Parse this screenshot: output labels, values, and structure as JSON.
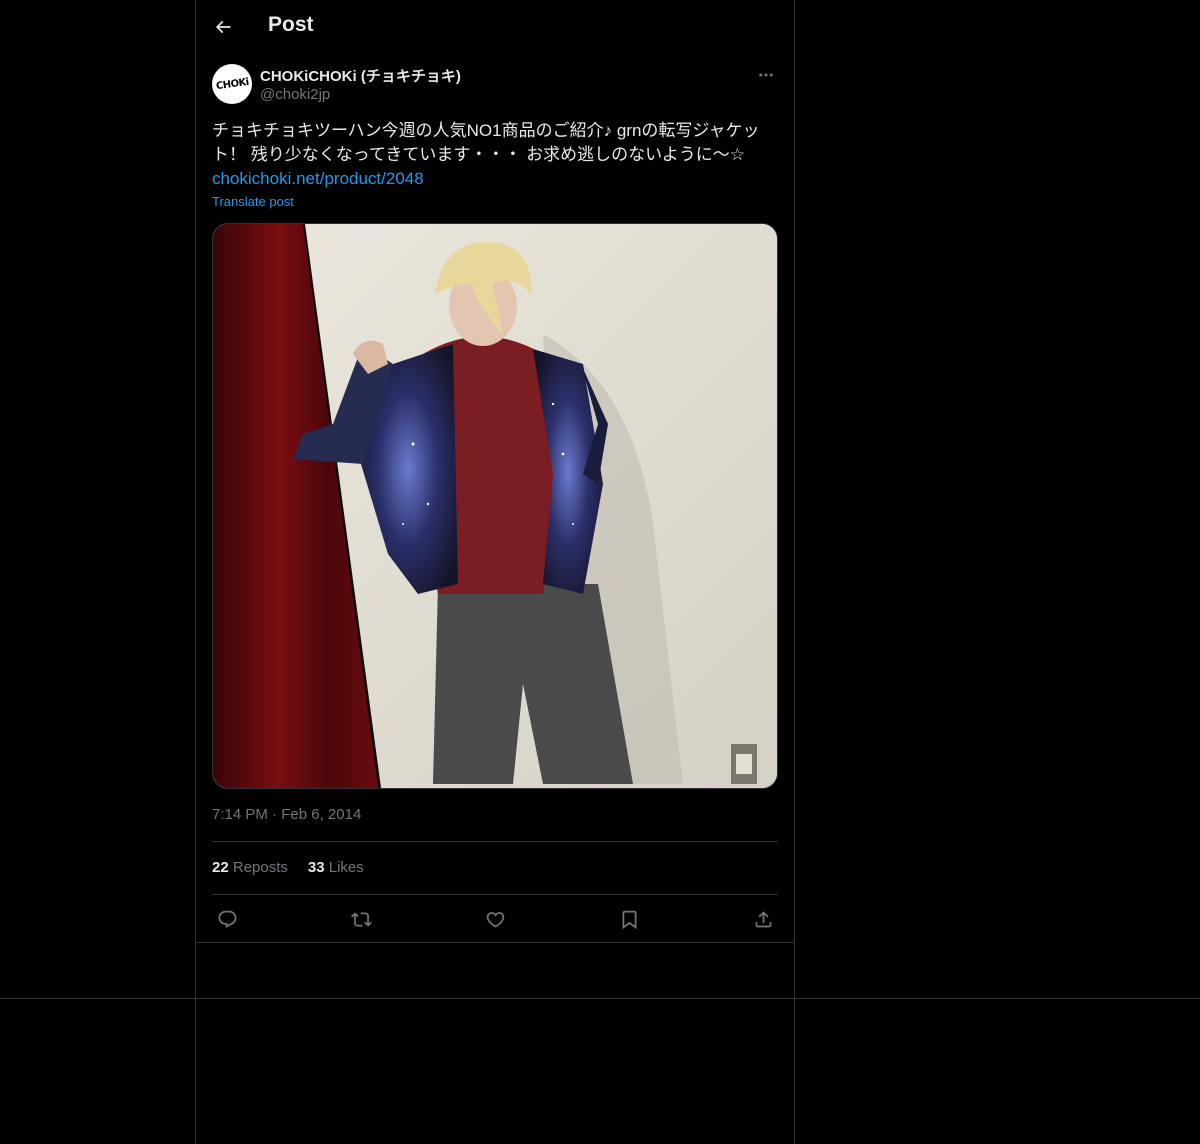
{
  "header": {
    "title": "Post"
  },
  "author": {
    "display_name": "CHOKiCHOKi (チョキチョキ)",
    "handle": "@choki2jp",
    "avatar_text": "CHOKi"
  },
  "tweet": {
    "text": "チョキチョキツーハン今週の人気NO1商品のご紹介♪ grnの転写ジャケット！ 残り少なくなってきています・・・ お求め逃しのないように〜☆",
    "link": "chokichoki.net/product/2048",
    "translate_label": "Translate post"
  },
  "meta": {
    "time": "7:14 PM",
    "separator": "·",
    "date": "Feb 6, 2014"
  },
  "stats": {
    "reposts_count": "22",
    "reposts_label": "Reposts",
    "likes_count": "33",
    "likes_label": "Likes"
  },
  "colors": {
    "background": "#000000",
    "text": "#e7e9ea",
    "muted": "#71767b",
    "link": "#1d9bf0",
    "border": "#2f3336"
  },
  "icons": [
    "arrow-left-icon",
    "more-icon",
    "reply-icon",
    "repost-icon",
    "like-icon",
    "bookmark-icon",
    "share-icon"
  ]
}
